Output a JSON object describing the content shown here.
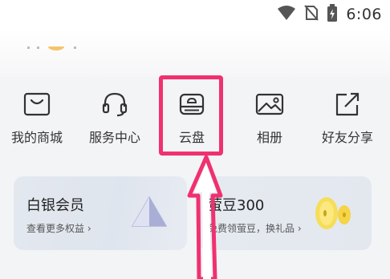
{
  "status_bar": {
    "time": "6:06",
    "icons": [
      "wifi-icon",
      "no-sim-icon",
      "battery-charging-icon"
    ]
  },
  "quick_menu": {
    "items": [
      {
        "label": "我的商城",
        "icon": "store-bag-icon"
      },
      {
        "label": "服务中心",
        "icon": "headset-icon"
      },
      {
        "label": "云盘",
        "icon": "cloud-drive-icon"
      },
      {
        "label": "相册",
        "icon": "photo-album-icon"
      },
      {
        "label": "好友分享",
        "icon": "share-icon"
      }
    ],
    "highlighted_item": "云盘"
  },
  "cards": {
    "silver_member": {
      "title": "白银会员",
      "subtitle": "查看更多权益 ›",
      "icon": "silver-triangle-icon"
    },
    "bean": {
      "title": "萤豆300",
      "subtitle": "免费领萤豆，换礼品 ›",
      "icon": "gold-bean-icon"
    }
  },
  "colors": {
    "annotation": "#f0316f",
    "icon_stroke": "#333333",
    "card_bg": "#e3e8ef"
  }
}
